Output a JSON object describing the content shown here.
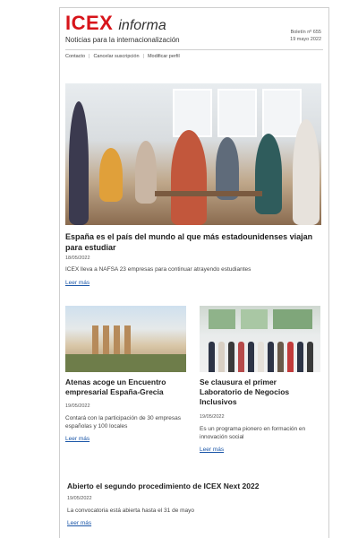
{
  "header": {
    "logo_brand": "ICEX",
    "logo_word": "informa",
    "tagline": "Noticias para la internacionalización",
    "bulletin_number": "Boletín nº 655",
    "bulletin_date": "19 mayo 2022"
  },
  "links": [
    "Contacto",
    "Cancelar suscripción",
    "Modificar perfil"
  ],
  "link_separator": "|",
  "articles": [
    {
      "title": "España es el país del mundo al que más estadounidenses viajan para estudiar",
      "date": "18/05/2022",
      "summary": "ICEX lleva a NAFSA 23 empresas para continuar atrayendo estudiantes",
      "more": "Leer más"
    },
    {
      "title": "Atenas acoge un Encuentro empresarial España-Grecia",
      "date": "19/05/2022",
      "summary": "Contará con la participación de 30 empresas españolas y 100 locales",
      "more": "Leer más"
    },
    {
      "title": "Se clausura el primer Laboratorio de Negocios Inclusivos",
      "date": "19/05/2022",
      "summary": "Es un programa pionero en formación en innovación social",
      "more": "Leer más"
    },
    {
      "title": "Abierto el segundo procedimiento de ICEX Next 2022",
      "date": "19/05/2022",
      "summary": "La convocatoria está abierta hasta el 31 de mayo",
      "more": "Leer más"
    }
  ],
  "colors": {
    "brand_red": "#d7141a",
    "link_blue": "#1a56a8"
  }
}
